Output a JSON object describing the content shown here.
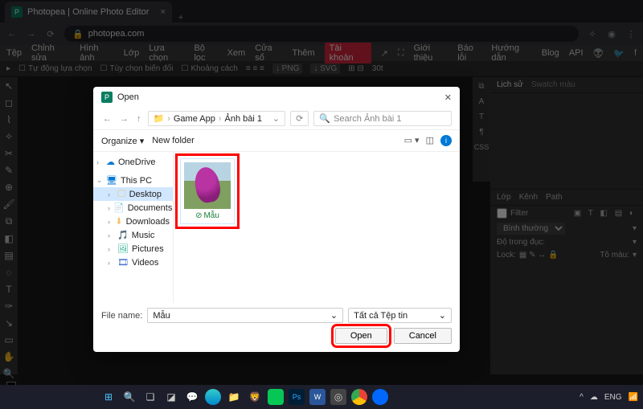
{
  "browser": {
    "tab_title": "Photopea | Online Photo Editor",
    "url": "photopea.com"
  },
  "menu": {
    "items": [
      "Tệp",
      "Chỉnh sửa",
      "Hình ảnh",
      "Lớp",
      "Lựa chọn",
      "Bộ lọc",
      "Xem",
      "Cửa sổ",
      "Thêm",
      "Tài khoản"
    ],
    "active_index": 9,
    "right": [
      "Giới thiệu",
      "Báo lỗi",
      "Hướng dẫn",
      "Blog",
      "API"
    ]
  },
  "toolbar2": {
    "auto_select": "Tự động lựa chọn",
    "layer_opts": "Tùy chọn biến đổi",
    "distance": "Khoảng cách",
    "export_btns": [
      "PNG",
      "SVG"
    ],
    "zoom": "30t"
  },
  "right_panel": {
    "tabs_top": {
      "history": "Lịch sử",
      "swatch": "Swatch màu"
    },
    "css_label": "CSS",
    "tabs_layers": {
      "layer": "Lớp",
      "channel": "Kênh",
      "path": "Path"
    },
    "filter_label": "Filter",
    "blend_mode": "Bình thường",
    "opacity_label": "Độ trong đục:",
    "opacity_value": "",
    "lock_label": "Lock:",
    "fill_label": "Tô màu:"
  },
  "dialog": {
    "title": "Open",
    "breadcrumb": {
      "root_icon": "📁",
      "seg1": "Game App",
      "seg2": "Ảnh bài 1"
    },
    "search_placeholder": "Search Ảnh bài 1",
    "organize": "Organize",
    "new_folder": "New folder",
    "tree": [
      {
        "label": "OneDrive",
        "icon": "cloud",
        "caret": ">"
      },
      {
        "label": "This PC",
        "icon": "pc",
        "caret": "v",
        "selected": true
      },
      {
        "label": "Desktop",
        "icon": "folder",
        "sub": true,
        "caret": ">",
        "sel": true
      },
      {
        "label": "Documents",
        "icon": "folder",
        "sub": true,
        "caret": ">"
      },
      {
        "label": "Downloads",
        "icon": "folder",
        "sub": true,
        "caret": ">"
      },
      {
        "label": "Music",
        "icon": "music",
        "sub": true,
        "caret": ">"
      },
      {
        "label": "Pictures",
        "icon": "pictures",
        "sub": true,
        "caret": ">"
      },
      {
        "label": "Videos",
        "icon": "videos",
        "sub": true,
        "caret": ">"
      }
    ],
    "file": {
      "name": "Mẫu"
    },
    "file_name_label": "File name:",
    "file_name_value": "Mẫu",
    "file_type": "Tất cả Tệp tin",
    "open_btn": "Open",
    "cancel_btn": "Cancel"
  },
  "taskbar": {
    "lang": "ENG"
  }
}
